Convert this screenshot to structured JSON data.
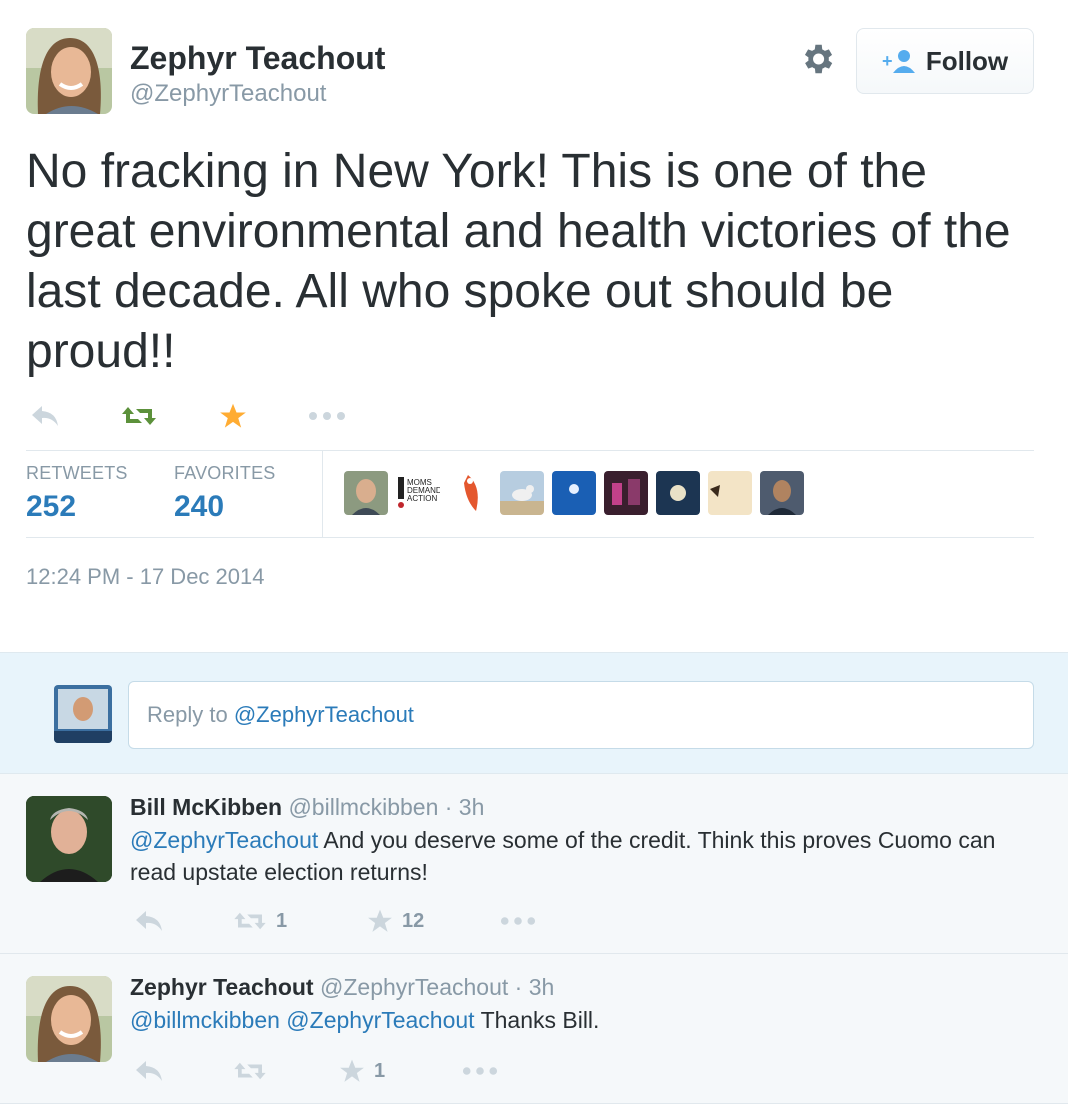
{
  "tweet": {
    "author_name": "Zephyr Teachout",
    "author_handle": "@ZephyrTeachout",
    "follow_label": "Follow",
    "text": "No fracking in New York! This is one of the great environmental and health victories of the last decade. All who spoke out should be proud!!",
    "stats": {
      "retweets_label": "RETWEETS",
      "retweets_value": "252",
      "favorites_label": "FAVORITES",
      "favorites_value": "240"
    },
    "timestamp": "12:24 PM - 17 Dec 2014",
    "favorited": true,
    "retweeted": true
  },
  "reply_box": {
    "prefix": "Reply to ",
    "mention": "@ZephyrTeachout"
  },
  "replies": [
    {
      "name": "Bill McKibben",
      "handle": "@billmckibben",
      "time": "· 3h",
      "mentions": [
        "@ZephyrTeachout"
      ],
      "text": "And you deserve some of the credit. Think this proves Cuomo can read upstate election returns!",
      "retweet_count": "1",
      "favorite_count": "12"
    },
    {
      "name": "Zephyr Teachout",
      "handle": "@ZephyrTeachout",
      "time": "· 3h",
      "mentions": [
        "@billmckibben",
        "@ZephyrTeachout"
      ],
      "text": "Thanks Bill.",
      "retweet_count": "",
      "favorite_count": "1"
    }
  ],
  "colors": {
    "link": "#2b7bb9",
    "retweet_active": "#5c913b",
    "favorite_active": "#ffac33",
    "muted": "#8899a6",
    "icon_inactive": "#ccd6dd"
  },
  "icons": {
    "reply": "reply-arrow-icon",
    "retweet": "retweet-arrows-icon",
    "favorite": "star-icon",
    "more": "ellipsis-icon",
    "settings": "gear-icon",
    "follow": "add-user-icon"
  }
}
